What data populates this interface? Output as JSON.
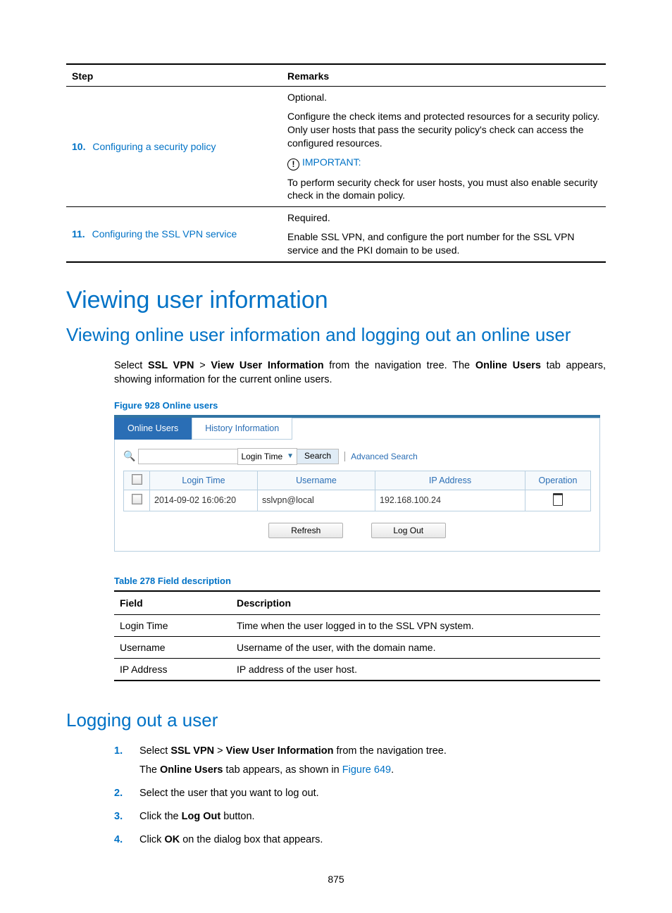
{
  "steps_table": {
    "headers": {
      "step": "Step",
      "remarks": "Remarks"
    },
    "rows": [
      {
        "num": "10.",
        "link_text": "Configuring a security policy",
        "remark_optional": "Optional.",
        "remark_desc": "Configure the check items and protected resources for a security policy. Only user hosts that pass the security policy's check can access the configured resources.",
        "important_label": "IMPORTANT:",
        "important_text": "To perform security check for user hosts, you must also enable security check in the domain policy."
      },
      {
        "num": "11.",
        "link_text": "Configuring the SSL VPN service",
        "remark_required": "Required.",
        "remark_desc": "Enable SSL VPN, and configure the port number for the SSL VPN service and the PKI domain to be used."
      }
    ]
  },
  "h1": "Viewing user information",
  "h2a": "Viewing online user information and logging out an online user",
  "intro": {
    "pre": "Select ",
    "b1": "SSL VPN",
    "gt": " > ",
    "b2": "View User Information",
    "mid": " from the navigation tree. The ",
    "b3": "Online Users",
    "post": " tab appears, showing information for the current online users."
  },
  "figure_caption": "Figure 928 Online users",
  "ui": {
    "tabs": {
      "active": "Online Users",
      "other": "History Information"
    },
    "search_field_dropdown": "Login Time",
    "search_button": "Search",
    "advanced_link": "Advanced Search",
    "columns": {
      "c1": "Login Time",
      "c2": "Username",
      "c3": "IP Address",
      "c4": "Operation"
    },
    "row": {
      "login_time": "2014-09-02 16:06:20",
      "username": "sslvpn@local",
      "ip": "192.168.100.24"
    },
    "refresh_btn": "Refresh",
    "logout_btn": "Log Out"
  },
  "table_caption": "Table 278 Field description",
  "field_table": {
    "headers": {
      "field": "Field",
      "desc": "Description"
    },
    "rows": [
      {
        "field": "Login Time",
        "desc": "Time when the user logged in to the SSL VPN system."
      },
      {
        "field": "Username",
        "desc": "Username of the user, with the domain name."
      },
      {
        "field": "IP Address",
        "desc": "IP address of the user host."
      }
    ]
  },
  "h2b": "Logging out a user",
  "logout_steps": {
    "s1_pre": "Select ",
    "s1_b1": "SSL VPN",
    "s1_gt": " > ",
    "s1_b2": "View User Information",
    "s1_post": " from the navigation tree.",
    "s1_sub_pre": "The ",
    "s1_sub_b": "Online Users",
    "s1_sub_mid": " tab appears, as shown in ",
    "s1_sub_link": "Figure 649",
    "s1_sub_end": ".",
    "s2": "Select the user that you want to log out.",
    "s3_pre": "Click the ",
    "s3_b": "Log Out",
    "s3_post": " button.",
    "s4_pre": "Click ",
    "s4_b": "OK",
    "s4_post": " on the dialog box that appears."
  },
  "page_number": "875"
}
